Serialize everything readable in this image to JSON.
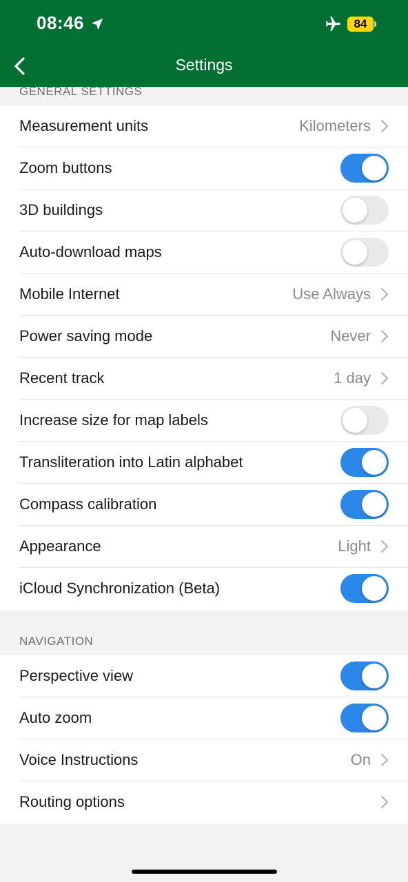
{
  "status_bar": {
    "time": "08:46",
    "battery": "84",
    "icons": [
      "location-arrow-icon",
      "airplane-icon",
      "battery-icon"
    ]
  },
  "nav": {
    "title": "Settings",
    "back_icon": "chevron-left-icon"
  },
  "colors": {
    "header": "#036f33",
    "toggle_on": "#2b87e8",
    "toggle_off": "#e9e9ea",
    "battery": "#ffd60a"
  },
  "sections": {
    "general": {
      "header": "GENERAL SETTINGS",
      "rows": [
        {
          "label": "Measurement units",
          "value": "Kilometers"
        },
        {
          "label": "Zoom buttons",
          "toggle": true
        },
        {
          "label": "3D buildings",
          "toggle": false
        },
        {
          "label": "Auto-download maps",
          "toggle": false
        },
        {
          "label": "Mobile Internet",
          "value": "Use Always"
        },
        {
          "label": "Power saving mode",
          "value": "Never"
        },
        {
          "label": "Recent track",
          "value": "1 day"
        },
        {
          "label": "Increase size for map labels",
          "toggle": false
        },
        {
          "label": "Transliteration into Latin alphabet",
          "toggle": true
        },
        {
          "label": "Compass calibration",
          "toggle": true
        },
        {
          "label": "Appearance",
          "value": "Light"
        },
        {
          "label": "iCloud Synchronization (Beta)",
          "toggle": true
        }
      ]
    },
    "navigation": {
      "header": "NAVIGATION",
      "rows": [
        {
          "label": "Perspective view",
          "toggle": true
        },
        {
          "label": "Auto zoom",
          "toggle": true
        },
        {
          "label": "Voice Instructions",
          "value": "On"
        },
        {
          "label": "Routing options",
          "value": ""
        }
      ]
    }
  }
}
